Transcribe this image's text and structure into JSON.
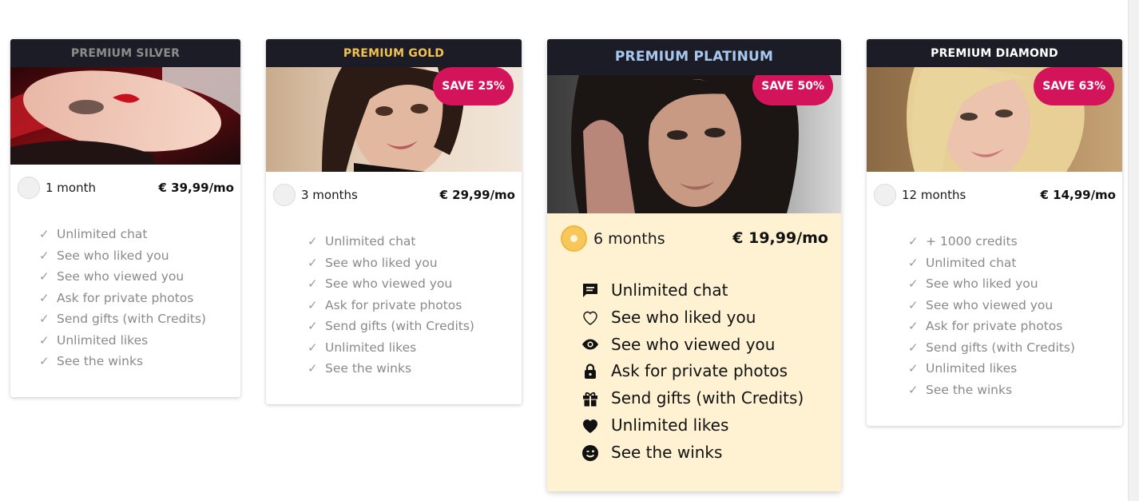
{
  "plans": [
    {
      "name": "PREMIUM SILVER",
      "name_color": "#8c8c8c",
      "duration": "1 month",
      "price": "€ 39,99/mo",
      "save": "",
      "features": [
        "Unlimited chat",
        "See who liked you",
        "See who viewed you",
        "Ask for private photos",
        "Send gifts (with Credits)",
        "Unlimited likes",
        "See the winks"
      ]
    },
    {
      "name": "PREMIUM GOLD",
      "name_color": "#f2c14e",
      "duration": "3 months",
      "price": "€ 29,99/mo",
      "save": "SAVE 25%",
      "features": [
        "Unlimited chat",
        "See who liked you",
        "See who viewed you",
        "Ask for private photos",
        "Send gifts (with Credits)",
        "Unlimited likes",
        "See the winks"
      ]
    },
    {
      "name": "PREMIUM PLATINUM",
      "name_color": "#a8c8f0",
      "duration": "6 months",
      "price": "€ 19,99/mo",
      "save": "SAVE 50%",
      "selected": true,
      "features": [
        {
          "label": "Unlimited chat",
          "icon": "chat-bubble-icon"
        },
        {
          "label": "See who liked you",
          "icon": "heart-outline-icon"
        },
        {
          "label": "See who viewed you",
          "icon": "eye-icon"
        },
        {
          "label": "Ask for private photos",
          "icon": "lock-icon"
        },
        {
          "label": "Send gifts (with Credits)",
          "icon": "gift-icon"
        },
        {
          "label": "Unlimited likes",
          "icon": "heart-filled-icon"
        },
        {
          "label": "See the winks",
          "icon": "wink-face-icon"
        }
      ]
    },
    {
      "name": "PREMIUM DIAMOND",
      "name_color": "#ffffff",
      "duration": "12 months",
      "price": "€ 14,99/mo",
      "save": "SAVE 63%",
      "features": [
        "+ 1000 credits",
        "Unlimited chat",
        "See who liked you",
        "See who viewed you",
        "Ask for private photos",
        "Send gifts (with Credits)",
        "Unlimited likes",
        "See the winks"
      ]
    }
  ],
  "check_glyph": "✓",
  "colors": {
    "header_bg": "#1c1c26",
    "save_badge": "#d4145a",
    "featured_bg": "#fef2d2",
    "selected_radio": "#f7c75a"
  }
}
